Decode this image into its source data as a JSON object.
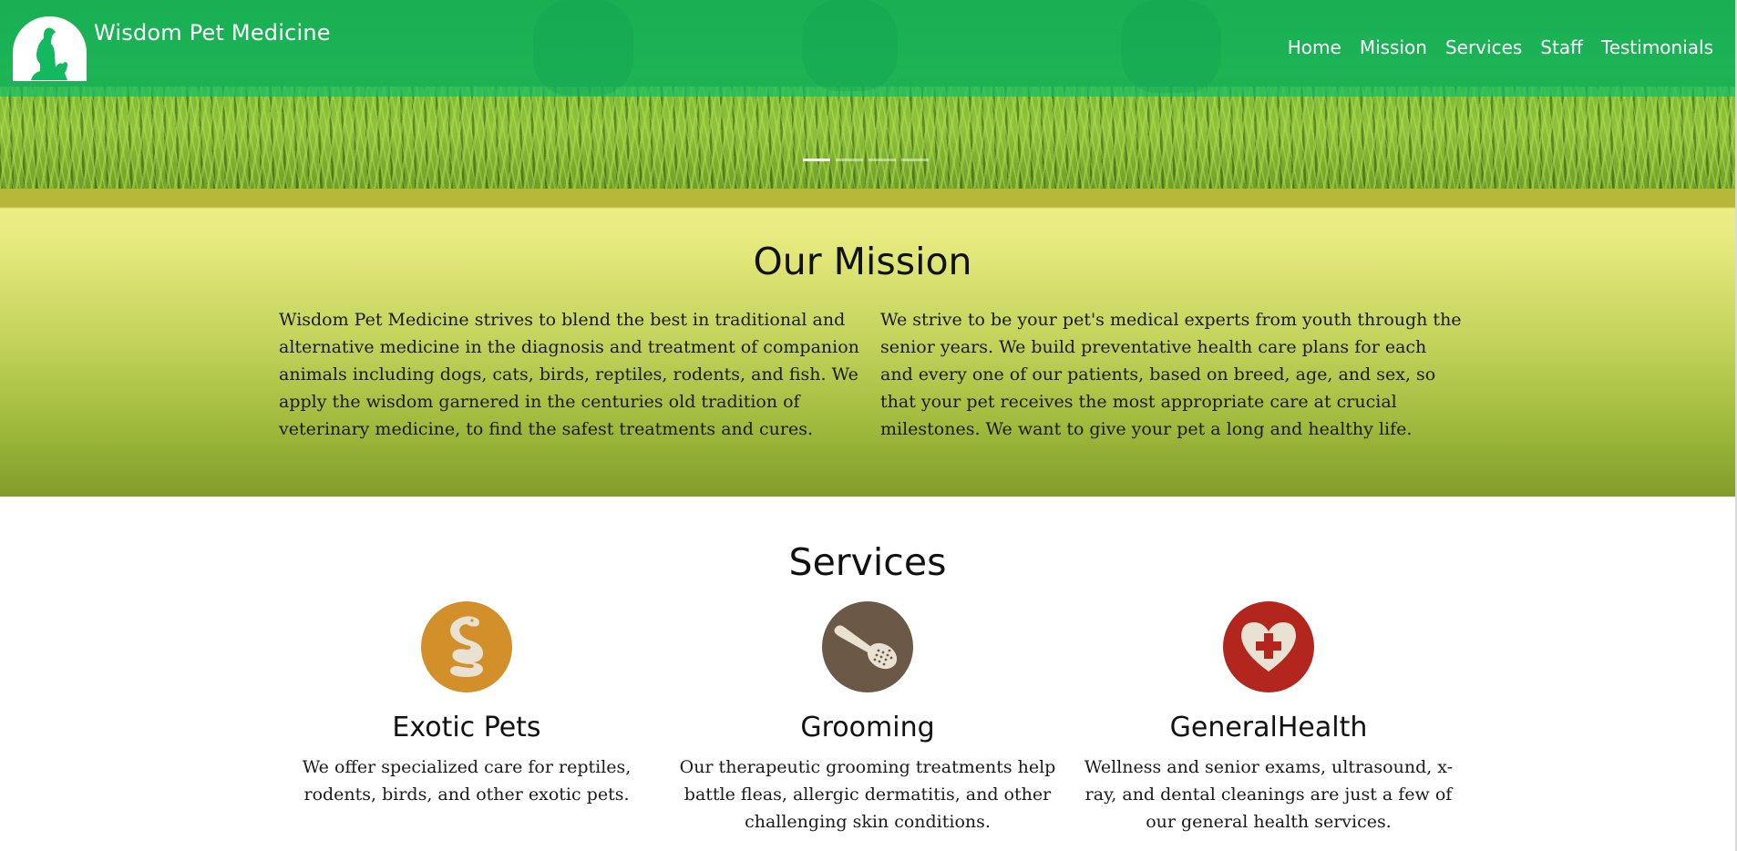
{
  "header": {
    "brand": "Wisdom Pet Medicine",
    "logo_icon": "dog-and-cat-silhouette-icon",
    "nav": [
      "Home",
      "Mission",
      "Services",
      "Staff",
      "Testimonials"
    ],
    "carousel_slide_count": 4,
    "carousel_active_index": 0
  },
  "mission": {
    "title": "Our Mission",
    "paragraph_left": "Wisdom Pet Medicine strives to blend the best in traditional and alternative medicine in the diagnosis and treatment of companion animals including dogs, cats, birds, reptiles, rodents, and fish. We apply the wisdom garnered in the centuries old tradition of veterinary medicine, to find the safest treatments and cures.",
    "paragraph_right": "We strive to be your pet's medical experts from youth through the senior years. We build preventative health care plans for each and every one of our patients, based on breed, age, and sex, so that your pet receives the most appropriate care at crucial milestones. We want to give your pet a long and healthy life."
  },
  "services": {
    "title": "Services",
    "items": [
      {
        "title": "Exotic Pets",
        "text": "We offer specialized care for reptiles, rodents, birds, and other exotic pets.",
        "icon": "snake-icon",
        "color": "#d38f2a"
      },
      {
        "title": "Grooming",
        "text": "Our therapeutic grooming treatments help battle fleas, allergic dermatitis, and other challenging skin conditions.",
        "icon": "grooming-brush-icon",
        "color": "#6b5846"
      },
      {
        "title": "GeneralHealth",
        "text": "Wellness and senior exams, ultrasound, x-ray, and dental cleanings are just a few of our general health services.",
        "icon": "heart-cross-icon",
        "color": "#b3261e"
      }
    ]
  },
  "colors": {
    "nav_band": "#10be64",
    "mission_top": "#ecee86",
    "mission_bottom": "#819c2a"
  }
}
